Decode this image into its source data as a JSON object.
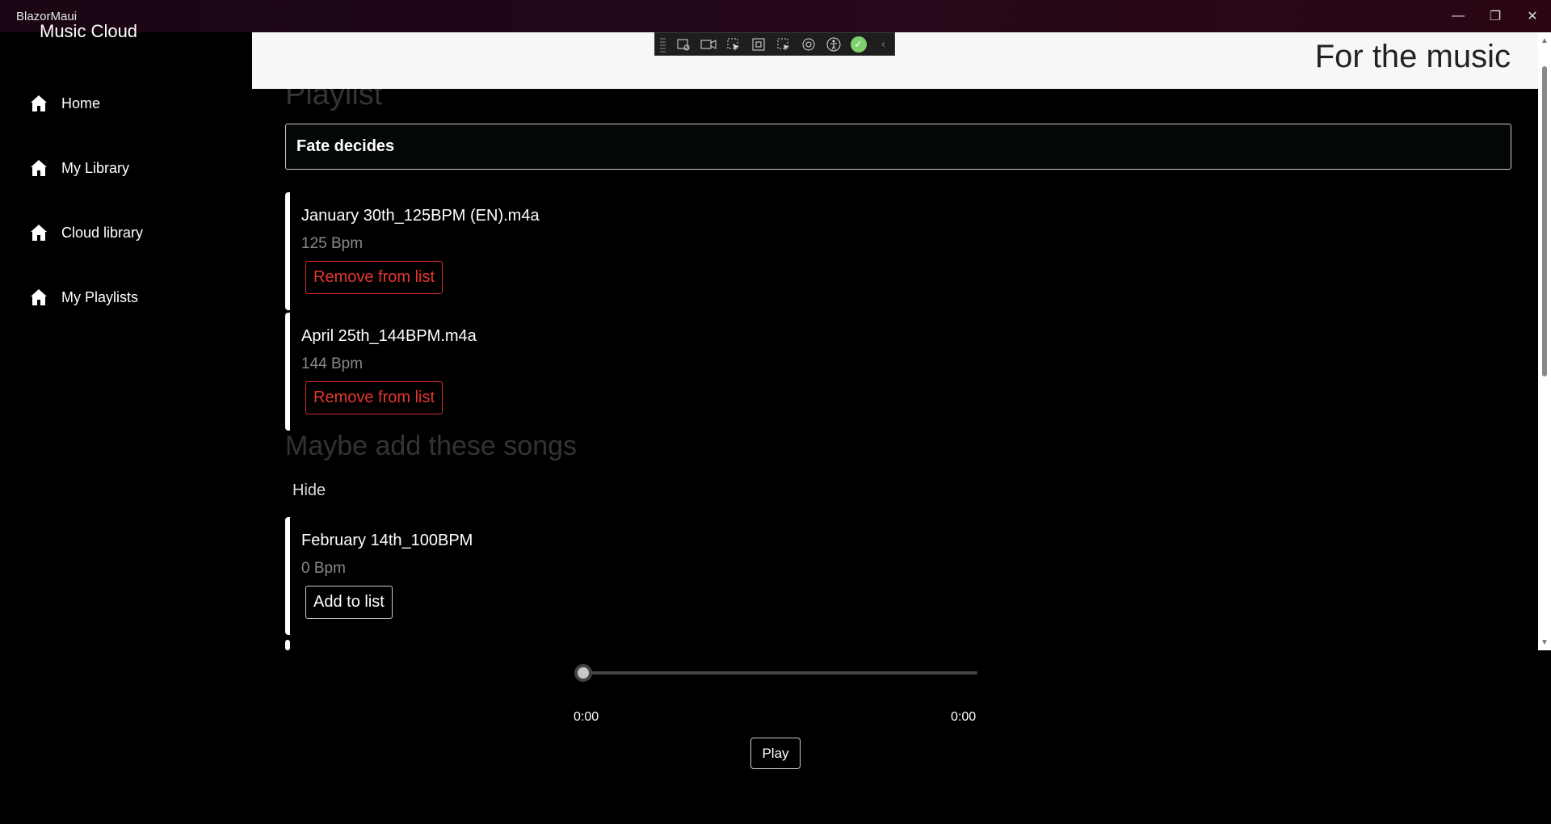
{
  "window": {
    "title": "BlazorMaui",
    "minimize_glyph": "—",
    "maximize_glyph": "❐",
    "close_glyph": "✕"
  },
  "sidebar": {
    "brand": "Music Cloud",
    "items": [
      {
        "label": "Home",
        "icon": "home-icon"
      },
      {
        "label": "My Library",
        "icon": "home-icon"
      },
      {
        "label": "Cloud library",
        "icon": "home-icon"
      },
      {
        "label": "My Playlists",
        "icon": "home-icon"
      }
    ]
  },
  "header": {
    "tagline": "For the music"
  },
  "main": {
    "heading": "Playlist",
    "playlist_name": "Fate decides",
    "songs": [
      {
        "title": "January 30th_125BPM (EN).m4a",
        "bpm": "125 Bpm",
        "action": "Remove from list"
      },
      {
        "title": "April 25th_144BPM.m4a",
        "bpm": "144 Bpm",
        "action": "Remove from list"
      }
    ],
    "suggestions_heading": "Maybe add these songs",
    "hide_label": "Hide",
    "suggestions": [
      {
        "title": "February 14th_100BPM",
        "bpm": "0 Bpm",
        "action": "Add to list"
      }
    ]
  },
  "player": {
    "progress": 0,
    "current_time": "0:00",
    "duration": "0:00",
    "play_label": "Play"
  },
  "colors": {
    "accent_red": "#e5342f",
    "header_bg": "#f7f7f8",
    "titlebar_bg": "#24081a"
  }
}
